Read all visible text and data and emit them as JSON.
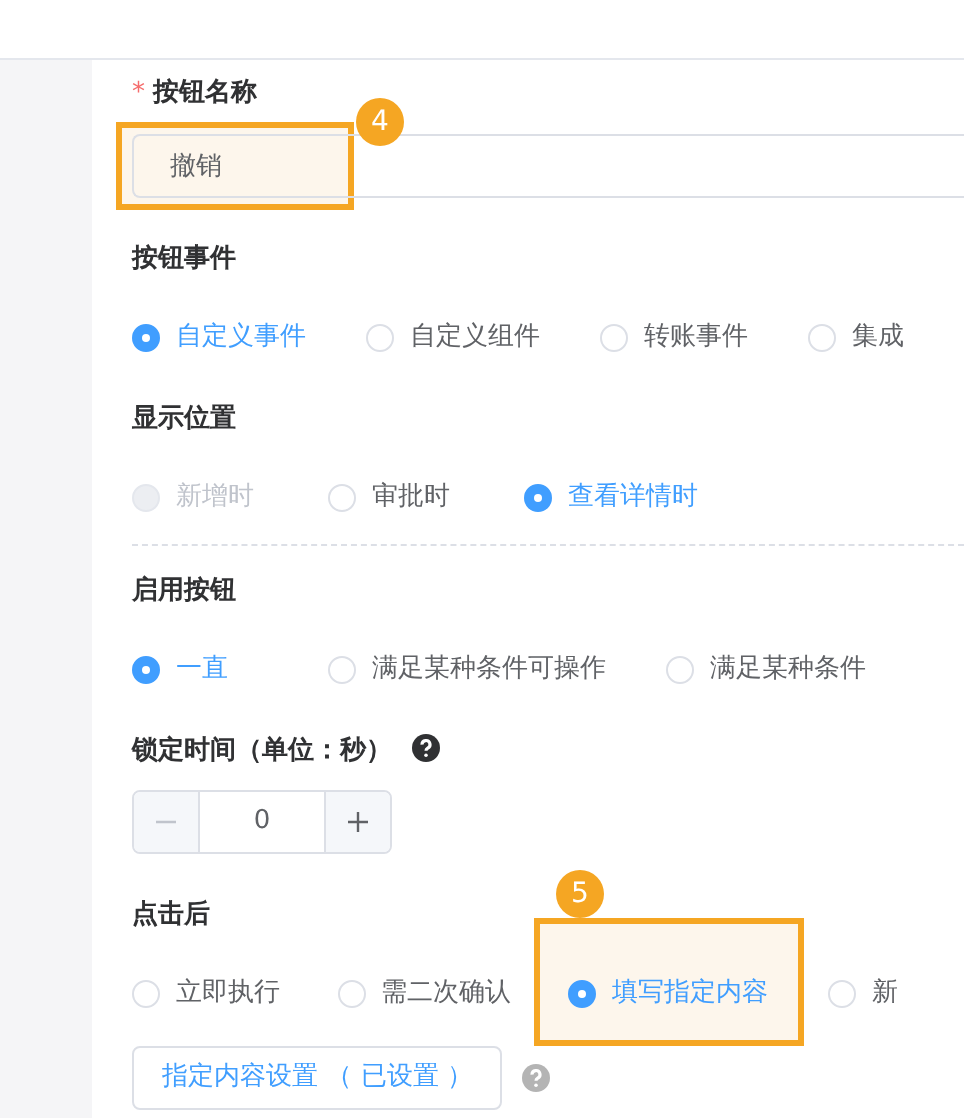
{
  "sections": [
    {
      "kind": "text",
      "label": "按钮名称",
      "required_mark": "*",
      "value": "撤销",
      "highlight": "4"
    },
    {
      "kind": "radio",
      "label": "按钮事件",
      "options": [
        {
          "label": "自定义事件",
          "selected": true,
          "disabled": false
        },
        {
          "label": "自定义组件",
          "selected": false,
          "disabled": false
        },
        {
          "label": "转账事件",
          "selected": false,
          "disabled": false
        },
        {
          "label": "集成",
          "selected": false,
          "disabled": false
        }
      ]
    },
    {
      "kind": "radio",
      "label": "显示位置",
      "divider": true,
      "options": [
        {
          "label": "新增时",
          "selected": false,
          "disabled": true
        },
        {
          "label": "审批时",
          "selected": false,
          "disabled": false
        },
        {
          "label": "查看详情时",
          "selected": true,
          "disabled": false
        }
      ]
    },
    {
      "kind": "radio",
      "label": "启用按钮",
      "options": [
        {
          "label": "一直",
          "selected": true,
          "disabled": false
        },
        {
          "label": "满足某种条件可操作",
          "selected": false,
          "disabled": false
        },
        {
          "label": "满足某种条件",
          "selected": false,
          "disabled": false
        }
      ]
    },
    {
      "kind": "stepper",
      "label": "锁定时间（单位：秒）",
      "help": true,
      "value": "0"
    },
    {
      "kind": "radio",
      "label": "点击后",
      "options": [
        {
          "label": "立即执行",
          "selected": false,
          "disabled": false
        },
        {
          "label": "需二次确认",
          "selected": false,
          "disabled": false
        },
        {
          "label": "填写指定内容",
          "selected": true,
          "disabled": false,
          "highlight": "5"
        },
        {
          "label": "新",
          "selected": false,
          "disabled": false
        }
      ],
      "button": {
        "label": "指定内容设置 （ 已设置 ）",
        "help": true
      }
    }
  ]
}
